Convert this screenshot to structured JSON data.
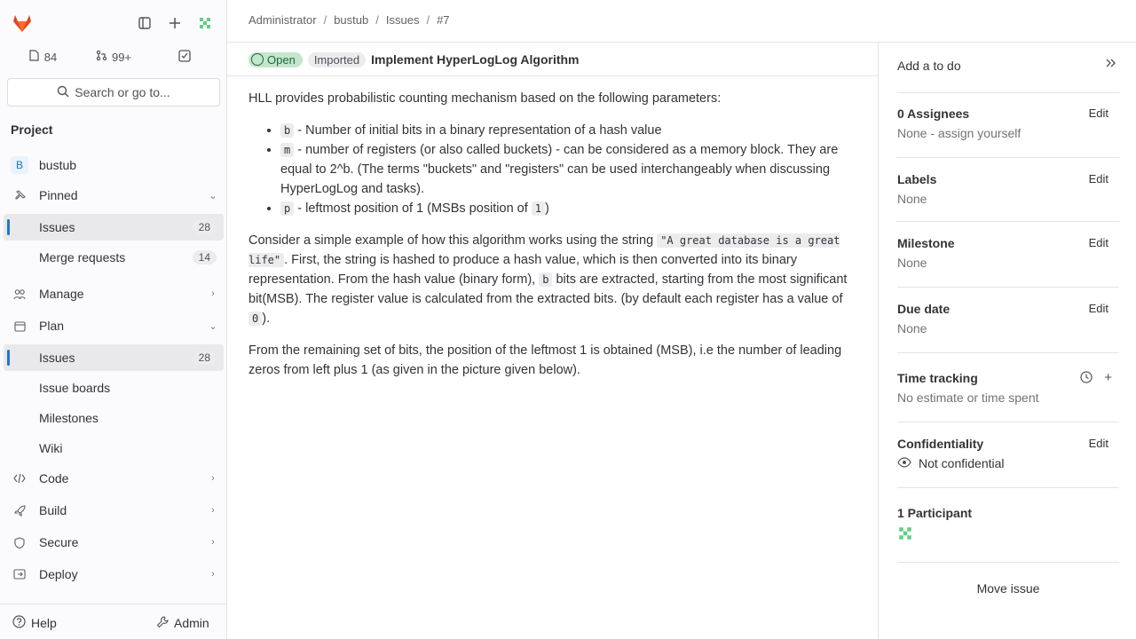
{
  "sidebar": {
    "top": {
      "logo_icon": "gitlab-logo-icon",
      "icons": [
        "panel-icon",
        "plus-icon",
        "user-avatar-icon"
      ]
    },
    "counters": [
      {
        "icon": "issues-icon",
        "value": "84"
      },
      {
        "icon": "merge-request-icon",
        "value": "99+"
      },
      {
        "icon": "todo-check-icon",
        "value": ""
      }
    ],
    "search_label": "Search or go to...",
    "section_title": "Project",
    "project": {
      "avatar_letter": "B",
      "name": "bustub"
    },
    "items": [
      {
        "label": "Pinned",
        "icon": "pin-icon",
        "chevron": "⌄",
        "count": ""
      },
      {
        "label": "Issues",
        "icon": "",
        "chevron": "",
        "count": "28"
      },
      {
        "label": "Merge requests",
        "icon": "",
        "chevron": "",
        "count": "14"
      },
      {
        "label": "Manage",
        "icon": "users-icon",
        "chevron": "›",
        "count": ""
      },
      {
        "label": "Plan",
        "icon": "plan-icon",
        "chevron": "⌄",
        "count": ""
      },
      {
        "label": "Issues",
        "icon": "",
        "chevron": "",
        "count": "28"
      },
      {
        "label": "Issue boards",
        "icon": "",
        "chevron": "",
        "count": ""
      },
      {
        "label": "Milestones",
        "icon": "",
        "chevron": "",
        "count": ""
      },
      {
        "label": "Wiki",
        "icon": "",
        "chevron": "",
        "count": ""
      },
      {
        "label": "Code",
        "icon": "code-icon",
        "chevron": "›",
        "count": ""
      },
      {
        "label": "Build",
        "icon": "rocket-icon",
        "chevron": "›",
        "count": ""
      },
      {
        "label": "Secure",
        "icon": "shield-icon",
        "chevron": "›",
        "count": ""
      },
      {
        "label": "Deploy",
        "icon": "deploy-icon",
        "chevron": "›",
        "count": ""
      }
    ],
    "help_label": "Help",
    "admin_label": "Admin"
  },
  "breadcrumb": [
    "Administrator",
    "bustub",
    "Issues",
    "#7"
  ],
  "issue": {
    "status": "Open",
    "imported": "Imported",
    "title": "Implement HyperLogLog Algorithm",
    "intro": "HLL provides probabilistic counting mechanism based on the following parameters:",
    "params": [
      {
        "code": "b",
        "text": " - Number of initial bits in a binary representation of a hash value"
      },
      {
        "code": "m",
        "text": " - number of registers (or also called buckets) - can be considered as a memory block. They are equal to 2^b. (The terms \"buckets\" and \"registers\" can be used interchangeably when discussing HyperLogLog and tasks)."
      },
      {
        "code": "p",
        "text": " - leftmost position of 1 (MSBs position of ",
        "code2": "1",
        "text2": ")"
      }
    ],
    "para2": {
      "a": "Consider a simple example of how this algorithm works using the string ",
      "code_a": "\"A great database is a great life\"",
      "b": ". First, the string is hashed to produce a hash value, which is then converted into its binary representation. From the hash value (binary form), ",
      "code_b": "b",
      "c": " bits are extracted, starting from the most significant bit(MSB). The register value is calculated from the extracted bits. (by default each register has a value of ",
      "code_c": "0",
      "d": ")."
    },
    "para3": "From the remaining set of bits, the position of the leftmost 1 is obtained (MSB), i.e the number of leading zeros from left plus 1 (as given in the picture given below)."
  },
  "right_sidebar": {
    "todo_label": "Add a to do",
    "assignees": {
      "title": "0 Assignees",
      "value": "None - ",
      "assign_link": "assign yourself",
      "edit": "Edit"
    },
    "labels": {
      "title": "Labels",
      "value": "None",
      "edit": "Edit"
    },
    "milestone": {
      "title": "Milestone",
      "value": "None",
      "edit": "Edit"
    },
    "due_date": {
      "title": "Due date",
      "value": "None",
      "edit": "Edit"
    },
    "time_tracking": {
      "title": "Time tracking",
      "value": "No estimate or time spent"
    },
    "confidentiality": {
      "title": "Confidentiality",
      "value": "Not confidential",
      "edit": "Edit"
    },
    "participants": {
      "title": "1 Participant"
    },
    "move_label": "Move issue"
  }
}
